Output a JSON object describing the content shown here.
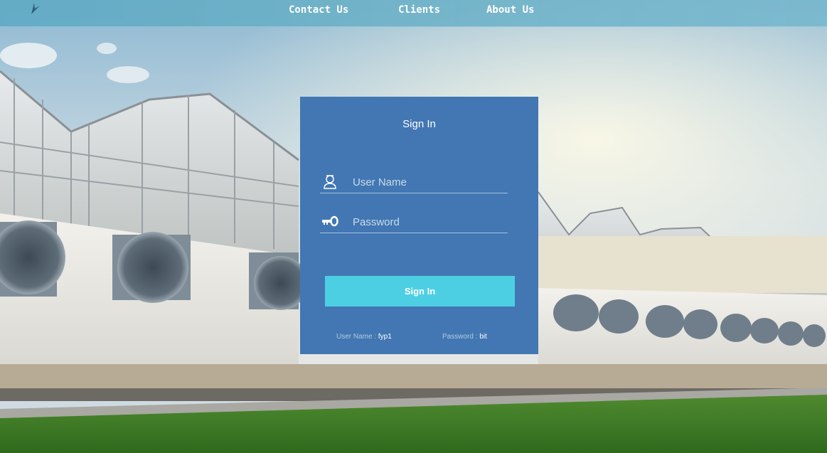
{
  "nav": {
    "links": [
      {
        "label": "Contact Us"
      },
      {
        "label": "Clients"
      },
      {
        "label": "About Us"
      }
    ]
  },
  "signin": {
    "title": "Sign In",
    "username": {
      "placeholder": "User Name",
      "value": "",
      "icon": "user-icon"
    },
    "password": {
      "placeholder": "Password",
      "value": "",
      "icon": "key-icon"
    },
    "submit_label": "Sign In",
    "hints": {
      "username_label": "User Name :",
      "username_value": "fyp1",
      "password_label": "Password :",
      "password_value": "bit"
    }
  },
  "colors": {
    "panel": "#4277b3",
    "button": "#4dcfe3",
    "nav_bar": "#6eb2c8"
  }
}
